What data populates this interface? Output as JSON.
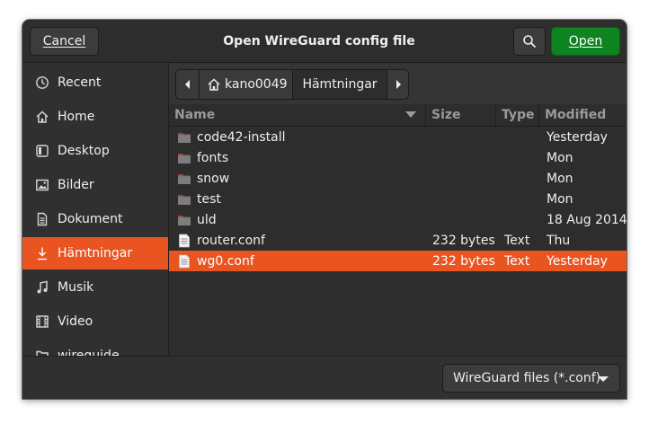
{
  "header": {
    "cancel_label": "Cancel",
    "title": "Open WireGuard config file",
    "open_label": "Open"
  },
  "sidebar": {
    "items": [
      {
        "label": "Recent",
        "icon": "clock-icon"
      },
      {
        "label": "Home",
        "icon": "home-icon"
      },
      {
        "label": "Desktop",
        "icon": "desktop-icon"
      },
      {
        "label": "Bilder",
        "icon": "pictures-icon"
      },
      {
        "label": "Dokument",
        "icon": "documents-icon"
      },
      {
        "label": "Hämtningar",
        "icon": "download-icon",
        "active": true
      },
      {
        "label": "Musik",
        "icon": "music-icon"
      },
      {
        "label": "Video",
        "icon": "video-icon"
      },
      {
        "label": "wireguide",
        "icon": "folder-icon"
      }
    ]
  },
  "pathbar": {
    "segments": [
      "kano0049",
      "Hämtningar"
    ]
  },
  "columns": {
    "name": "Name",
    "size": "Size",
    "type": "Type",
    "modified": "Modified"
  },
  "files": [
    {
      "name": "code42-install",
      "size": "",
      "type": "",
      "modified": "Yesterday",
      "kind": "folder"
    },
    {
      "name": "fonts",
      "size": "",
      "type": "",
      "modified": "Mon",
      "kind": "folder"
    },
    {
      "name": "snow",
      "size": "",
      "type": "",
      "modified": "Mon",
      "kind": "folder"
    },
    {
      "name": "test",
      "size": "",
      "type": "",
      "modified": "Mon",
      "kind": "folder"
    },
    {
      "name": "uld",
      "size": "",
      "type": "",
      "modified": "18 Aug 2014",
      "kind": "folder"
    },
    {
      "name": "router.conf",
      "size": "232 bytes",
      "type": "Text",
      "modified": "Thu",
      "kind": "file"
    },
    {
      "name": "wg0.conf",
      "size": "232 bytes",
      "type": "Text",
      "modified": "Yesterday",
      "kind": "file",
      "selected": true
    }
  ],
  "filter": {
    "label": "WireGuard files (*.conf)"
  },
  "colors": {
    "accent": "#e95420",
    "open_button": "#0e8420",
    "folder": "#6f6f6f",
    "folder_tab": "#c0392b"
  }
}
